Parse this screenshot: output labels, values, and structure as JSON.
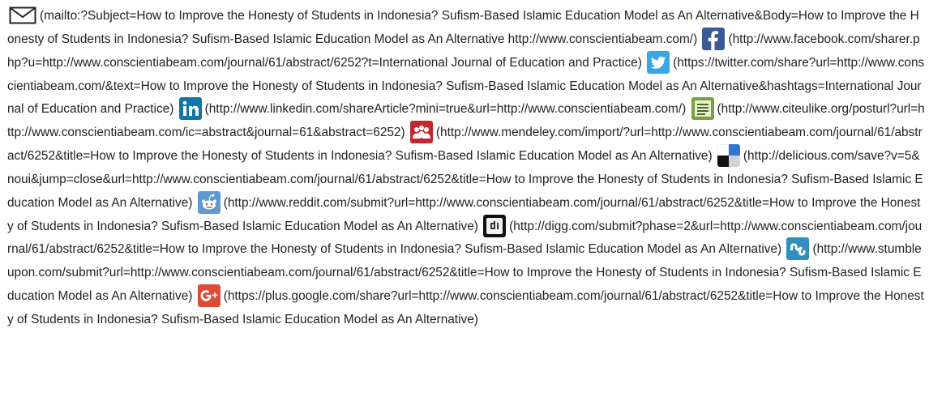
{
  "icons": {
    "email": "envelope-icon",
    "facebook": "facebook-icon",
    "twitter": "twitter-icon",
    "linkedin": "linkedin-icon",
    "citeulike": "citeulike-icon",
    "mendeley": "mendeley-icon",
    "delicious": "delicious-icon",
    "reddit": "reddit-icon",
    "digg": "digg-icon",
    "stumbleupon": "stumbleupon-icon",
    "googleplus": "google-plus-icon"
  },
  "colors": {
    "facebook": "#3b5998",
    "twitter": "#39a7e6",
    "linkedin": "#0e76a8",
    "citeulike": "#76a33a",
    "mendeley": "#c4262e",
    "reddit": "#5f99cf",
    "stumbleupon": "#2f8fbf",
    "googleplus": "#dd4b39"
  },
  "links": [
    "(mailto:?Subject=How to Improve the Honesty of Students in Indonesia? Sufism-Based Islamic Education Model as An Alternative&Body=How to Improve the Honesty of Students in Indonesia? Sufism-Based Islamic Education Model as An Alternative http://www.conscientiabeam.com/)",
    "(http://www.facebook.com/sharer.php?u=http://www.conscientiabeam.com/journal/61/abstract/6252?t=International Journal of Education and Practice)",
    "(https://twitter.com/share?url=http://www.conscientiabeam.com/&text=How to Improve the Honesty of Students in Indonesia? Sufism-Based Islamic Education Model as An Alternative&hashtags=International Journal of Education and Practice)",
    "(http://www.linkedin.com/shareArticle?mini=true&url=http://www.conscientiabeam.com/)",
    "(http://www.citeulike.org/posturl?url=http://www.conscientiabeam.com/ic=abstract&journal=61&abstract=6252)",
    "(http://www.mendeley.com/import/?url=http://www.conscientiabeam.com/journal/61/abstract/6252&title=How to Improve the Honesty of Students in Indonesia? Sufism-Based Islamic Education Model as An Alternative)",
    "(http://delicious.com/save?v=5&noui&jump=close&url=http://www.conscientiabeam.com/journal/61/abstract/6252&title=How to Improve the Honesty of Students in Indonesia? Sufism-Based Islamic Education Model as An Alternative)",
    "(http://www.reddit.com/submit?url=http://www.conscientiabeam.com/journal/61/abstract/6252&title=How to Improve the Honesty of Students in Indonesia? Sufism-Based Islamic Education Model as An Alternative)",
    "(http://digg.com/submit?phase=2&url=http://www.conscientiabeam.com/journal/61/abstract/6252&title=How to Improve the Honesty of Students in Indonesia? Sufism-Based Islamic Education Model as An Alternative)",
    "(http://www.stumbleupon.com/submit?url=http://www.conscientiabeam.com/journal/61/abstract/6252&title=How to Improve the Honesty of Students in Indonesia? Sufism-Based Islamic Education Model as An Alternative)",
    "(https://plus.google.com/share?url=http://www.conscientiabeam.com/journal/61/abstract/6252&title=How to Improve the Honesty of Students in Indonesia? Sufism-Based Islamic Education Model as An Alternative)"
  ]
}
